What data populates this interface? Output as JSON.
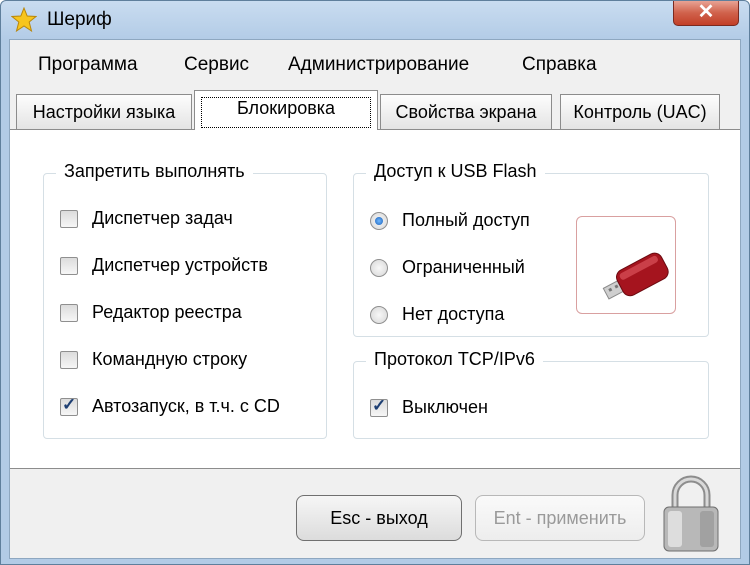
{
  "window": {
    "title": "Шериф",
    "close_glyph": "✕",
    "icon": "star-icon"
  },
  "menu": [
    {
      "label": "Программа"
    },
    {
      "label": "Сервис"
    },
    {
      "label": "Администрирование"
    },
    {
      "label": "Справка"
    }
  ],
  "tabs": [
    {
      "label": "Настройки языка",
      "active": false
    },
    {
      "label": "Блокировка",
      "active": true
    },
    {
      "label": "Свойства экрана",
      "active": false
    },
    {
      "label": "Контроль (UAC)",
      "active": false
    }
  ],
  "block_group": {
    "title": "Запретить выполнять",
    "items": [
      {
        "label": "Диспетчер задач",
        "checked": false
      },
      {
        "label": "Диспетчер устройств",
        "checked": false
      },
      {
        "label": "Редактор реестра",
        "checked": false
      },
      {
        "label": "Командную строку",
        "checked": false
      },
      {
        "label": "Автозапуск, в т.ч. с CD",
        "checked": true
      }
    ]
  },
  "usb_group": {
    "title": "Доступ к USB Flash",
    "options": [
      {
        "label": "Полный доступ",
        "selected": true
      },
      {
        "label": "Ограниченный",
        "selected": false
      },
      {
        "label": "Нет доступа",
        "selected": false
      }
    ],
    "image": "usb-flash-drive-icon"
  },
  "tcp_group": {
    "title": "Протокол TCP/IPv6",
    "item": {
      "label": "Выключен",
      "checked": true
    }
  },
  "buttons": {
    "exit_label": "Esc - выход",
    "apply_label": "Ent - применить"
  },
  "check_glyph": "✓",
  "colors": {
    "accent": "#1e3f73",
    "close": "#c23f27"
  }
}
